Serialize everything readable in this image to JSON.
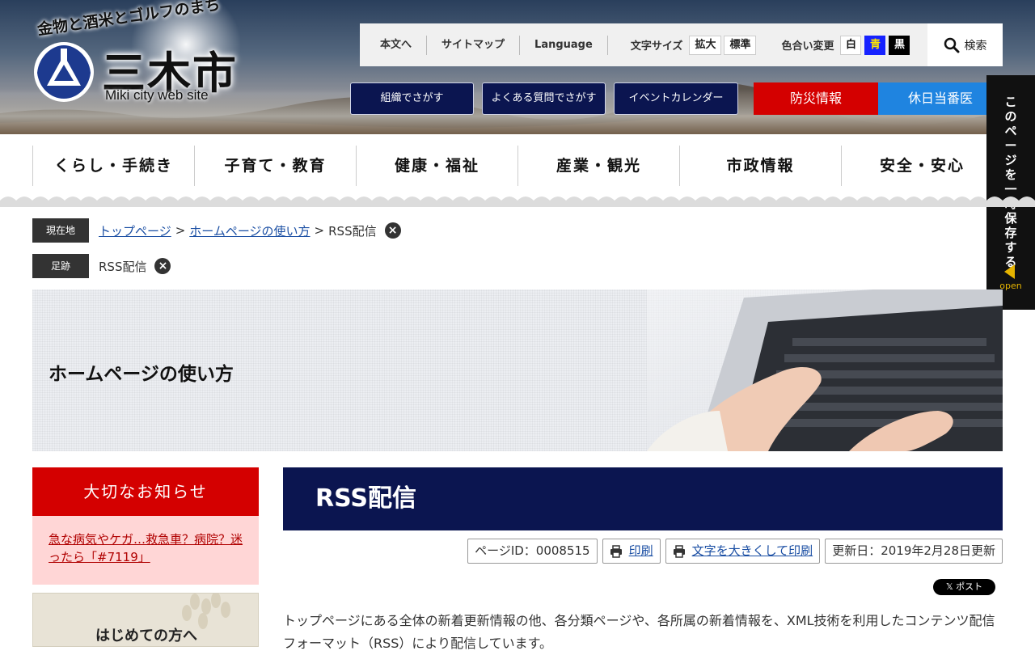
{
  "header": {
    "catchcopy": "金物と酒米とゴルフのまち",
    "city_name": "三木市",
    "site_sub": "Miki city web site",
    "util_links": [
      "本文へ",
      "サイトマップ",
      "Language"
    ],
    "font_size_label": "文字サイズ",
    "font_size_buttons": [
      "拡大",
      "標準"
    ],
    "color_label": "色合い変更",
    "color_buttons": [
      "白",
      "青",
      "黒"
    ],
    "search_label": "検索",
    "nav_buttons": [
      "組織でさがす",
      "よくある質問でさがす",
      "イベントカレンダー"
    ],
    "disaster_label": "防災情報",
    "holiday_doctor_label": "休日当番医"
  },
  "side_tab": {
    "label": "このページを一時保存する",
    "open_label": "open"
  },
  "global_nav": [
    "くらし・手続き",
    "子育て・教育",
    "健康・福祉",
    "産業・観光",
    "市政情報",
    "安全・安心"
  ],
  "breadcrumb": {
    "current_label": "現在地",
    "items": [
      "トップページ",
      "ホームページの使い方",
      "RSS配信"
    ],
    "history_label": "足跡",
    "history_items": [
      "RSS配信"
    ]
  },
  "hero": {
    "title": "ホームページの使い方"
  },
  "sidebar": {
    "notice_title": "大切なお知らせ",
    "notice_link": "急な病気やケガ…救急車？病院？迷ったら「#7119」",
    "beginner_label": "はじめての方へ"
  },
  "main": {
    "title": "RSS配信",
    "page_id": "ページID：0008515",
    "print_label": "印刷",
    "print_large_label": "文字を大きくして印刷",
    "updated": "更新日：2019年2月28日更新",
    "post_button": "𝕏 ポスト",
    "body": "トップページにある全体の新着更新情報の他、各分類ページや、各所属の新着情報を、XML技術を利用したコンテンツ配信フォーマット（RSS）により配信しています。"
  },
  "colors": {
    "navy": "#0b1550",
    "red": "#d40000",
    "blue": "#1f84e0",
    "pink": "#ffd6d6"
  }
}
